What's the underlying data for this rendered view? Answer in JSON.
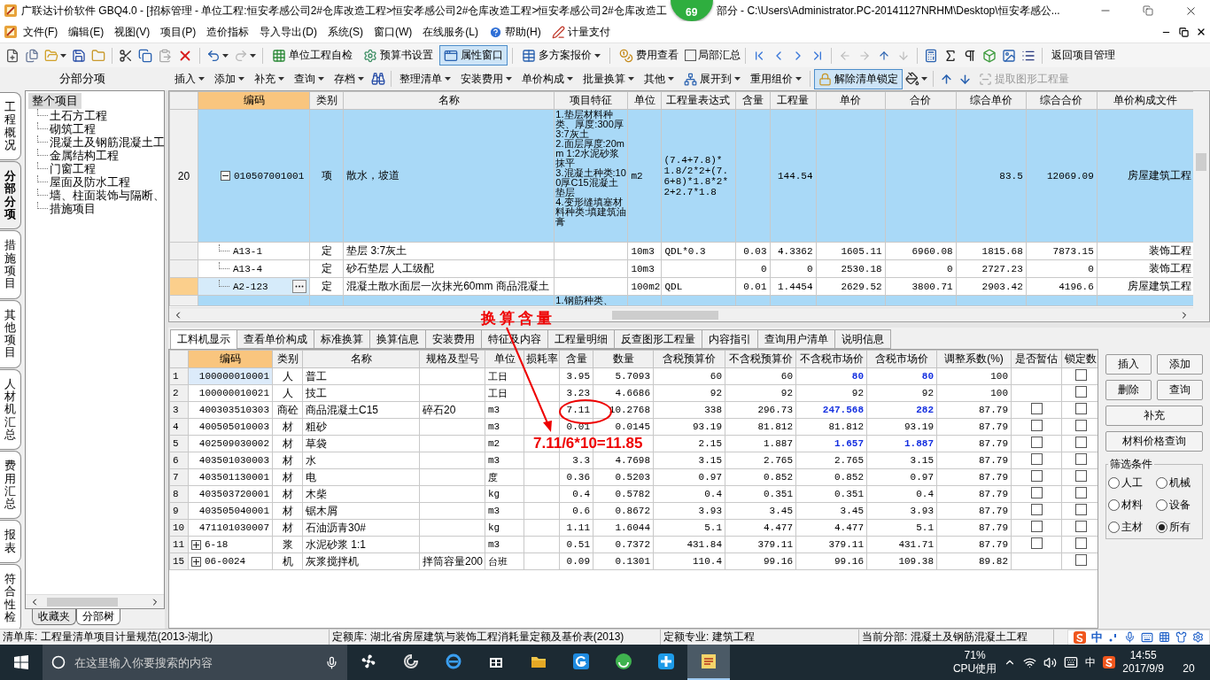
{
  "window": {
    "title": "广联达计价软件 GBQ4.0 - [招标管理 - 单位工程:恒安孝感公司2#仓库改造工程>恒安孝感公司2#仓库改造工程>恒安孝感公司2#仓库改造工",
    "badge": "69",
    "title_tail": "部分 - C:\\Users\\Administrator.PC-20141127NRHM\\Desktop\\恒安孝感公..."
  },
  "menu": [
    {
      "kind": "plain",
      "label": "文件(F)"
    },
    {
      "kind": "plain",
      "label": "编辑(E)"
    },
    {
      "kind": "plain",
      "label": "视图(V)"
    },
    {
      "kind": "plain",
      "label": "项目(P)"
    },
    {
      "kind": "plain",
      "label": "造价指标"
    },
    {
      "kind": "plain",
      "label": "导入导出(D)"
    },
    {
      "kind": "plain",
      "label": "系统(S)"
    },
    {
      "kind": "plain",
      "label": "窗口(W)"
    },
    {
      "kind": "plain",
      "label": "在线服务(L)"
    },
    {
      "kind": "help",
      "label": "帮助(H)"
    },
    {
      "kind": "pay",
      "label": "计量支付"
    }
  ],
  "toolbar": [
    {
      "kind": "button",
      "label": "单位工程自检",
      "selected": false
    },
    {
      "kind": "button",
      "label": "预算书设置",
      "selected": false
    },
    {
      "kind": "button",
      "label": "属性窗口",
      "selected": true
    },
    {
      "kind": "dropdown",
      "label": "多方案报价",
      "selected": false
    },
    {
      "kind": "button",
      "label": "费用查看",
      "selected": false
    },
    {
      "kind": "checkbox",
      "label": "局部汇总",
      "checked": false
    },
    {
      "kind": "return",
      "label": "返回项目管理",
      "selected": false
    }
  ],
  "pane": {
    "title": "分部分项"
  },
  "actions": [
    {
      "kind": "menu",
      "label": "插入",
      "disabled": false
    },
    {
      "kind": "menu",
      "label": "添加",
      "disabled": false
    },
    {
      "kind": "menu",
      "label": "补充",
      "disabled": false
    },
    {
      "kind": "menu",
      "label": "查询",
      "disabled": false
    },
    {
      "kind": "menu",
      "label": "存档",
      "disabled": false
    },
    {
      "kind": "find"
    },
    {
      "kind": "menu",
      "label": "整理清单",
      "disabled": false
    },
    {
      "kind": "menu",
      "label": "安装费用",
      "disabled": false
    },
    {
      "kind": "menu",
      "label": "单价构成",
      "disabled": false
    },
    {
      "kind": "menu",
      "label": "批量换算",
      "disabled": false
    },
    {
      "kind": "menu",
      "label": "其他",
      "disabled": false
    },
    {
      "kind": "tree-menu",
      "label": "展开到",
      "disabled": false
    },
    {
      "kind": "menu",
      "label": "重用组价",
      "disabled": false
    },
    {
      "kind": "lock",
      "label": "解除清单锁定",
      "on": true,
      "disabled": false
    },
    {
      "kind": "fill"
    },
    {
      "kind": "up"
    },
    {
      "kind": "down"
    },
    {
      "kind": "extract",
      "label": "提取图形工程量",
      "disabled": true
    }
  ],
  "left_tabs": [
    {
      "label": "工程概况",
      "selected": false
    },
    {
      "label": "分部分项",
      "selected": true
    },
    {
      "label": "措施项目",
      "selected": false
    },
    {
      "label": "其他项目",
      "selected": false
    },
    {
      "label": "人材机汇总",
      "selected": false
    },
    {
      "label": "费用汇总",
      "selected": false
    },
    {
      "label": "报表",
      "selected": false
    },
    {
      "label": "符合性检",
      "selected": false
    }
  ],
  "tree": {
    "label": "整个项目",
    "selected": true,
    "children": [
      {
        "label": "土石方工程",
        "selected": false
      },
      {
        "label": "砌筑工程",
        "selected": false
      },
      {
        "label": "混凝土及钢筋混凝土工",
        "selected": false
      },
      {
        "label": "金属结构工程",
        "selected": false
      },
      {
        "label": "门窗工程",
        "selected": false
      },
      {
        "label": "屋面及防水工程",
        "selected": false
      },
      {
        "label": "墙、柱面装饰与隔断、",
        "selected": false
      },
      {
        "label": "措施项目",
        "selected": false
      }
    ]
  },
  "tree_tabs": [
    {
      "label": "收藏夹",
      "selected": false
    },
    {
      "label": "分部树",
      "selected": true
    }
  ],
  "upper_table": {
    "columns": [
      "编码",
      "类别",
      "名称",
      "项目特征",
      "单位",
      "工程量表达式",
      "含量",
      "工程量",
      "单价",
      "合价",
      "综合单价",
      "综合合价",
      "单价构成文件"
    ],
    "rows": [
      {
        "kind": "item",
        "num": "20",
        "expanded": true,
        "current": false,
        "code": "010507001001",
        "type": "项",
        "name": "散水，坡道",
        "feature": "1.垫层材料种类、厚度:300厚3:7灰土\n2.面层厚度:20mm 1:2水泥砂浆抹平\n3.混凝土种类:100厚C15混凝土垫层\n4.变形缝填塞材料种类:填建筑油膏",
        "unit": "m2",
        "expr": "(7.4+7.8)*1.8/2*2+(7.6+8)*1.8*2*2+2.7*1.8",
        "qty": "144.54",
        "comp_price": "83.5",
        "comp_total": "12069.09",
        "file": "房屋建筑工程"
      },
      {
        "kind": "norm",
        "current": false,
        "code": "A13-1",
        "type": "定",
        "name": "垫层 3:7灰土",
        "unit": "10m3",
        "expr": "QDL*0.3",
        "content": "0.03",
        "qty": "4.3362",
        "price": "1605.11",
        "total": "6960.08",
        "comp_price": "1815.68",
        "comp_total": "7873.15",
        "file": "装饰工程"
      },
      {
        "kind": "norm",
        "current": false,
        "code": "A13-4",
        "type": "定",
        "name": "砂石垫层 人工级配",
        "unit": "10m3",
        "content": "0",
        "qty": "0",
        "price": "2530.18",
        "total": "0",
        "comp_price": "2727.23",
        "comp_total": "0",
        "file": "装饰工程"
      },
      {
        "kind": "norm",
        "current": true,
        "code": "A2-123",
        "type": "定",
        "name": "混凝土散水面层一次抹光60mm 商品混凝土",
        "unit": "100m2",
        "expr": "QDL",
        "content": "0.01",
        "qty": "1.4454",
        "price": "2629.52",
        "total": "3800.71",
        "comp_price": "2903.42",
        "comp_total": "4196.6",
        "file": "房屋建筑工程"
      },
      {
        "kind": "item",
        "partial": true,
        "current": false,
        "feature": "1.钢筋种类、"
      }
    ]
  },
  "lower_tabs": [
    {
      "label": "工料机显示",
      "selected": true
    },
    {
      "label": "查看单价构成",
      "selected": false
    },
    {
      "label": "标准换算",
      "selected": false
    },
    {
      "label": "换算信息",
      "selected": false
    },
    {
      "label": "安装费用",
      "selected": false
    },
    {
      "label": "特征及内容",
      "selected": false
    },
    {
      "label": "工程量明细",
      "selected": false
    },
    {
      "label": "反查图形工程量",
      "selected": false
    },
    {
      "label": "内容指引",
      "selected": false
    },
    {
      "label": "查询用户清单",
      "selected": false
    },
    {
      "label": "说明信息",
      "selected": false
    }
  ],
  "lower_table": {
    "columns": [
      "编码",
      "类别",
      "名称",
      "规格及型号",
      "单位",
      "损耗率",
      "含量",
      "数量",
      "含税预算价",
      "不含税预算价",
      "不含税市场价",
      "含税市场价",
      "调整系数(%)",
      "是否暂估",
      "锁定数"
    ],
    "rows": [
      {
        "num": "1",
        "code": "100000010001",
        "type": "人",
        "name": "普工",
        "unit": "工日",
        "content": "3.95",
        "qty": "5.7093",
        "tax_budget": "60",
        "notax_budget": "60",
        "notax_market": "80",
        "tax_market": "80",
        "coef": "100",
        "market_changed": true,
        "locked": false,
        "selected": true
      },
      {
        "num": "2",
        "code": "100000010021",
        "type": "人",
        "name": "技工",
        "unit": "工日",
        "content": "3.23",
        "qty": "4.6686",
        "tax_budget": "92",
        "notax_budget": "92",
        "notax_market": "92",
        "tax_market": "92",
        "coef": "100",
        "market_changed": false,
        "locked": false,
        "selected": false
      },
      {
        "num": "3",
        "code": "400303510303",
        "type": "商砼",
        "name": "商品混凝土C15",
        "spec": "碎石20",
        "unit": "m3",
        "content": "7.11",
        "qty": "10.2768",
        "tax_budget": "338",
        "notax_budget": "296.73",
        "notax_market": "247.568",
        "tax_market": "282",
        "coef": "87.79",
        "market_changed": true,
        "provisional": false,
        "locked": false,
        "selected": false
      },
      {
        "num": "4",
        "code": "400505010003",
        "type": "材",
        "name": "粗砂",
        "unit": "m3",
        "content": "0.01",
        "qty": "0.0145",
        "tax_budget": "93.19",
        "notax_budget": "81.812",
        "notax_market": "81.812",
        "tax_market": "93.19",
        "coef": "87.79",
        "market_changed": false,
        "provisional": false,
        "locked": false,
        "selected": false
      },
      {
        "num": "5",
        "code": "402509030002",
        "type": "材",
        "name": "草袋",
        "unit": "m2",
        "tax_budget": "2.15",
        "notax_budget": "1.887",
        "notax_market": "1.657",
        "tax_market": "1.887",
        "coef": "87.79",
        "market_changed": true,
        "provisional": false,
        "locked": false,
        "selected": false
      },
      {
        "num": "6",
        "code": "403501030003",
        "type": "材",
        "name": "水",
        "unit": "m3",
        "content": "3.3",
        "qty": "4.7698",
        "tax_budget": "3.15",
        "notax_budget": "2.765",
        "notax_market": "2.765",
        "tax_market": "3.15",
        "coef": "87.79",
        "market_changed": false,
        "provisional": false,
        "locked": false,
        "selected": false
      },
      {
        "num": "7",
        "code": "403501130001",
        "type": "材",
        "name": "电",
        "unit": "度",
        "content": "0.36",
        "qty": "0.5203",
        "tax_budget": "0.97",
        "notax_budget": "0.852",
        "notax_market": "0.852",
        "tax_market": "0.97",
        "coef": "87.79",
        "market_changed": false,
        "provisional": false,
        "locked": false,
        "selected": false
      },
      {
        "num": "8",
        "code": "403503720001",
        "type": "材",
        "name": "木柴",
        "unit": "kg",
        "content": "0.4",
        "qty": "0.5782",
        "tax_budget": "0.4",
        "notax_budget": "0.351",
        "notax_market": "0.351",
        "tax_market": "0.4",
        "coef": "87.79",
        "market_changed": false,
        "provisional": false,
        "locked": false,
        "selected": false
      },
      {
        "num": "9",
        "code": "403505040001",
        "type": "材",
        "name": "锯木屑",
        "unit": "m3",
        "content": "0.6",
        "qty": "0.8672",
        "tax_budget": "3.93",
        "notax_budget": "3.45",
        "notax_market": "3.45",
        "tax_market": "3.93",
        "coef": "87.79",
        "market_changed": false,
        "provisional": false,
        "locked": false,
        "selected": false
      },
      {
        "num": "10",
        "code": "471101030007",
        "type": "材",
        "name": "石油沥青30#",
        "unit": "kg",
        "content": "1.11",
        "qty": "1.6044",
        "tax_budget": "5.1",
        "notax_budget": "4.477",
        "notax_market": "4.477",
        "tax_market": "5.1",
        "coef": "87.79",
        "market_changed": false,
        "provisional": false,
        "locked": false,
        "selected": false
      },
      {
        "num": "11",
        "expanded": false,
        "code": "6-18",
        "type": "浆",
        "name": "水泥砂浆 1:1",
        "unit": "m3",
        "content": "0.51",
        "qty": "0.7372",
        "tax_budget": "431.84",
        "notax_budget": "379.11",
        "notax_market": "379.11",
        "tax_market": "431.71",
        "coef": "87.79",
        "market_changed": false,
        "provisional": false,
        "locked": false,
        "selected": false
      },
      {
        "num": "15",
        "expanded": false,
        "code": "06-0024",
        "type": "机",
        "name": "灰浆搅拌机",
        "spec": "拌筒容量200",
        "unit": "台班",
        "content": "0.09",
        "qty": "0.1301",
        "tax_budget": "110.4",
        "notax_budget": "99.16",
        "notax_market": "99.16",
        "tax_market": "109.38",
        "coef": "89.82",
        "market_changed": false,
        "locked": false,
        "selected": false
      }
    ]
  },
  "side_buttons": [
    {
      "label": "插入",
      "wide": false
    },
    {
      "label": "添加",
      "wide": false
    },
    {
      "label": "删除",
      "wide": false
    },
    {
      "label": "查询",
      "wide": false
    },
    {
      "label": "补充",
      "wide": true
    },
    {
      "label": "材料价格查询",
      "wide": true
    }
  ],
  "filter": {
    "title": "筛选条件",
    "options": [
      {
        "label": "人工",
        "selected": false
      },
      {
        "label": "机械",
        "selected": false
      },
      {
        "label": "材料",
        "selected": false
      },
      {
        "label": "设备",
        "selected": false
      },
      {
        "label": "主材",
        "selected": false
      },
      {
        "label": "所有",
        "selected": true
      }
    ]
  },
  "annotations": [
    {
      "kind": "label",
      "text": "换算含量"
    },
    {
      "kind": "formula",
      "text": "7.11/6*10=11.85"
    }
  ],
  "status_bar": [
    "清单库: 工程量清单项目计量规范(2013-湖北)",
    "定额库: 湖北省房屋建筑与装饰工程消耗量定额及基价表(2013)",
    "定额专业: 建筑工程",
    "当前分部: 混凝土及钢筋混凝土工程"
  ],
  "ime": {
    "mode": "中"
  },
  "taskbar": {
    "search_placeholder": "在这里输入你要搜索的内容",
    "apps": [
      {
        "kind": "fan",
        "selected": false
      },
      {
        "kind": "swirl",
        "selected": false
      },
      {
        "kind": "browser",
        "selected": false
      },
      {
        "kind": "store",
        "selected": false
      },
      {
        "kind": "folder",
        "selected": false
      },
      {
        "kind": "g-app",
        "selected": false
      },
      {
        "kind": "circle-app",
        "selected": false
      },
      {
        "kind": "plus-app",
        "selected": false
      },
      {
        "kind": "notes",
        "selected": true
      }
    ],
    "cpu_value": "71%",
    "cpu_label": "CPU使用",
    "input_mode": "中",
    "time": "14:55",
    "date": "2017/9/9",
    "notifications": "20"
  }
}
